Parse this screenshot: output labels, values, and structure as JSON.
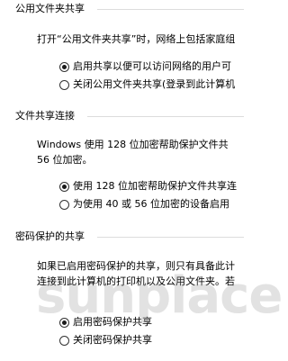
{
  "sections": {
    "public_folder": {
      "title": "公用文件夹共享",
      "description": "打开“公用文件夹共享”时，网络上包括家庭组",
      "options": [
        {
          "label": "启用共享以便可以访问网络的用户可",
          "checked": true
        },
        {
          "label": "关闭公用文件夹共享(登录到此计算机",
          "checked": false
        }
      ]
    },
    "file_sharing_connection": {
      "title": "文件共享连接",
      "description_line1": "Windows 使用 128 位加密帮助保护文件共",
      "description_line2": "56 位加密。",
      "options": [
        {
          "label": "使用 128 位加密帮助保护文件共享连",
          "checked": true
        },
        {
          "label": "为使用 40 或 56 位加密的设备启用",
          "checked": false
        }
      ]
    },
    "password_protected": {
      "title": "密码保护的共享",
      "description_line1": "如果已启用密码保护的共享，则只有具备此计",
      "description_line2": "连接到此计算机的打印机以及公用文件夹。若",
      "options": [
        {
          "label": "启用密码保护共享",
          "checked": true
        },
        {
          "label": "关闭密码保护共享",
          "checked": false
        }
      ]
    }
  },
  "watermark": "sunplace"
}
